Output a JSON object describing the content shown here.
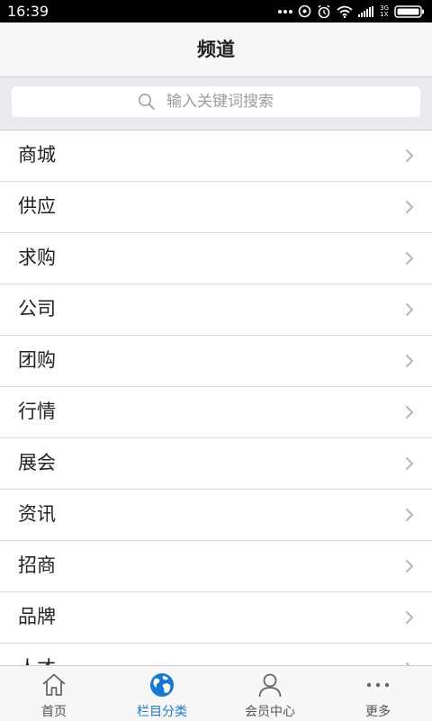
{
  "status_bar": {
    "time": "16:39",
    "network_label": "3G",
    "network_sub": "1X"
  },
  "header": {
    "title": "频道"
  },
  "search": {
    "placeholder": "输入关键词搜索"
  },
  "channels": [
    {
      "label": "商城"
    },
    {
      "label": "供应"
    },
    {
      "label": "求购"
    },
    {
      "label": "公司"
    },
    {
      "label": "团购"
    },
    {
      "label": "行情"
    },
    {
      "label": "展会"
    },
    {
      "label": "资讯"
    },
    {
      "label": "招商"
    },
    {
      "label": "品牌"
    },
    {
      "label": "人才"
    }
  ],
  "tabs": [
    {
      "label": "首页",
      "icon": "home-icon"
    },
    {
      "label": "栏目分类",
      "icon": "globe-icon",
      "active": true
    },
    {
      "label": "会员中心",
      "icon": "user-icon"
    },
    {
      "label": "更多",
      "icon": "more-icon"
    }
  ],
  "colors": {
    "accent": "#1479d9",
    "navbar_bg": "#f7f7f7",
    "text": "#222222"
  }
}
